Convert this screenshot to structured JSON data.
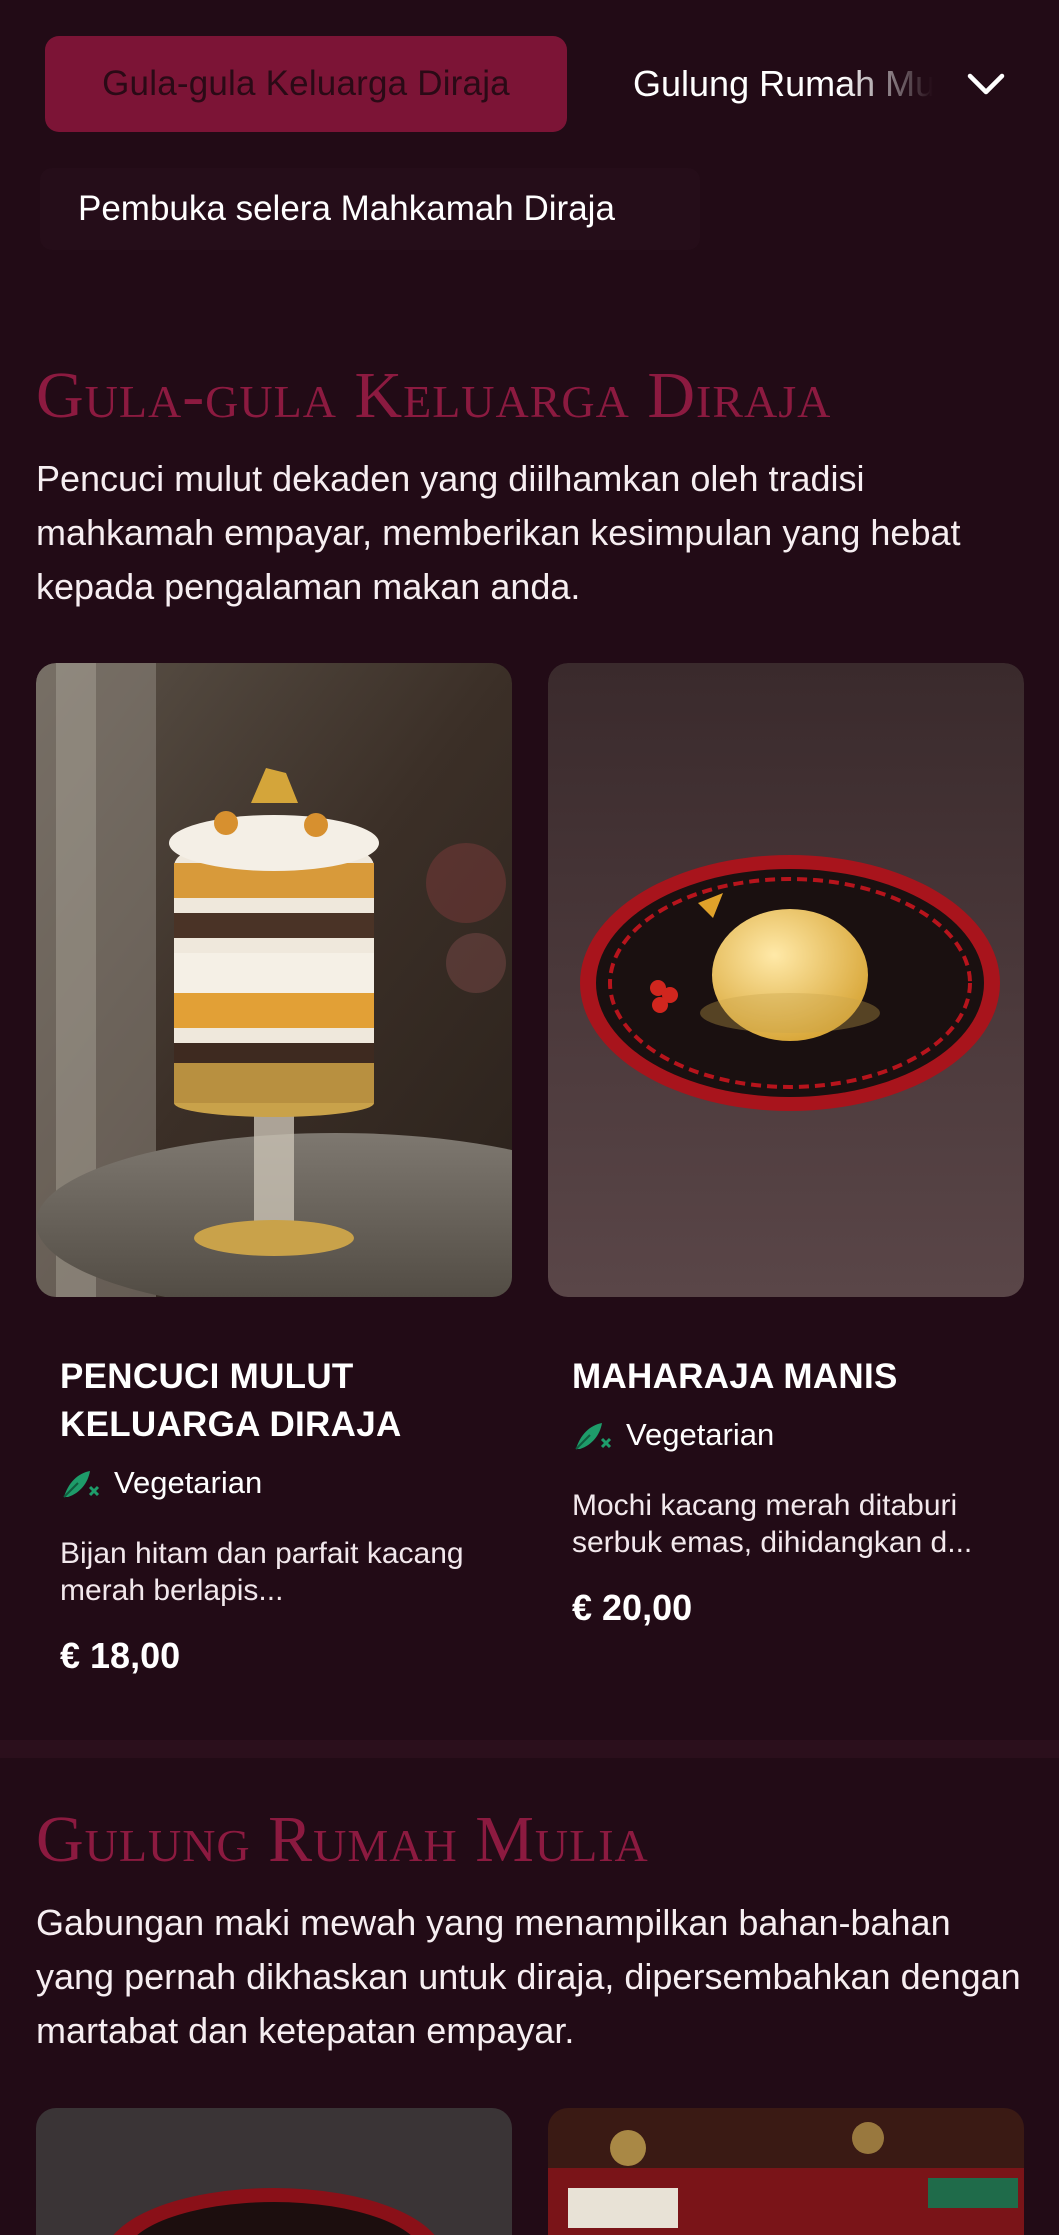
{
  "category_bar": {
    "active": "Gula-gula Keluarga Diraja",
    "next": "Gulung Rumah Mulia",
    "sub": "Pembuka selera Mahkamah Diraja",
    "chevron_icon": "chevron-down-icon"
  },
  "sections": [
    {
      "title": "Gula-gula Keluarga Diraja",
      "description": "Pencuci mulut dekaden yang diilhamkan oleh tradisi mahkamah empayar, memberikan kesimpulan yang hebat kepada pengalaman makan anda.",
      "items": [
        {
          "name": "PENCUCI MULUT KELUARGA DIRAJA",
          "tag": "Vegetarian",
          "description": "Bijan hitam dan parfait kacang merah berlapis...",
          "price": "€ 18,00"
        },
        {
          "name": "MAHARAJA MANIS",
          "tag": "Vegetarian",
          "description": "Mochi kacang merah ditaburi serbuk emas, dihidangkan d...",
          "price": "€ 20,00"
        }
      ]
    },
    {
      "title": "Gulung Rumah Mulia",
      "description": "Gabungan maki mewah yang menampilkan bahan-bahan yang pernah dikhaskan untuk diraja, dipersembahkan dengan martabat dan ketepatan empayar."
    }
  ],
  "colors": {
    "background": "#220b16",
    "accent": "#7c1436",
    "title": "#8c1a40",
    "vegetarian_icon": "#1e9c6a"
  }
}
